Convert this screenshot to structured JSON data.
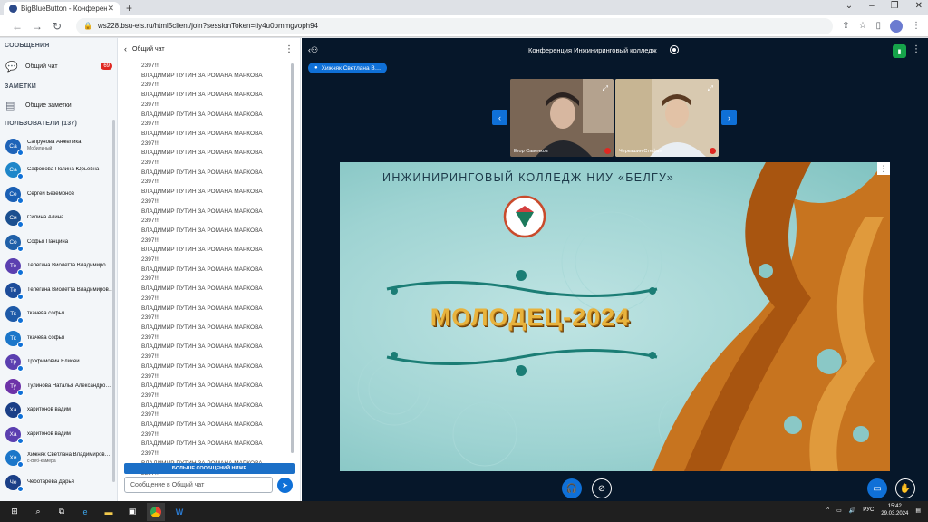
{
  "browser": {
    "tab_title": "BigBlueButton - Конферен…",
    "url": "ws228.bsu-eis.ru/html5client/join?sessionToken=tiy4u0pmmgvoph94"
  },
  "left_panel": {
    "messages_heading": "СООБЩЕНИЯ",
    "public_chat_label": "Общий чат",
    "public_chat_badge": "69",
    "notes_heading": "ЗАМЕТКИ",
    "shared_notes_label": "Общие заметки",
    "users_heading": "ПОЛЬЗОВАТЕЛИ (137)",
    "users": [
      {
        "initials": "Са",
        "name": "Сапрунова Анжелика",
        "sub": "Мобильный",
        "color": "#1e63b8"
      },
      {
        "initials": "Са",
        "name": "Сафонова Полина Юрьевна",
        "sub": "",
        "color": "#1e86c9"
      },
      {
        "initials": "Се",
        "name": "Сергей Беземонов",
        "sub": "",
        "color": "#1a5fb4"
      },
      {
        "initials": "Си",
        "name": "Силина Алина",
        "sub": "",
        "color": "#1b4f8f"
      },
      {
        "initials": "Со",
        "name": "Софья Панцина",
        "sub": "",
        "color": "#2060a8"
      },
      {
        "initials": "Те",
        "name": "Телегина Виолетта Владимиро…",
        "sub": "",
        "color": "#5b3fb0"
      },
      {
        "initials": "Те",
        "name": "Телегина Виолетта Владимиров…",
        "sub": "",
        "color": "#1d4c9a"
      },
      {
        "initials": "Тк",
        "name": "ткачева софья",
        "sub": "",
        "color": "#1e5aa8"
      },
      {
        "initials": "Тк",
        "name": "ткачева софья",
        "sub": "",
        "color": "#1b76c9"
      },
      {
        "initials": "Тр",
        "name": "Трофимович Елисей",
        "sub": "",
        "color": "#5b3fb0"
      },
      {
        "initials": "Ту",
        "name": "Тулинова Наталья Александро…",
        "sub": "",
        "color": "#6d32a8"
      },
      {
        "initials": "Ха",
        "name": "харитонов вадим",
        "sub": "",
        "color": "#1b3f87"
      },
      {
        "initials": "Ха",
        "name": "харитонов вадим",
        "sub": "",
        "color": "#5b3fb0"
      },
      {
        "initials": "Хи",
        "name": "Хижняк Светлана Владимиров…",
        "sub": "с-Веб-камера",
        "color": "#1b76c9"
      },
      {
        "initials": "Че",
        "name": "Чеботарева Дарья",
        "sub": "",
        "color": "#1b3f87"
      }
    ]
  },
  "chat": {
    "title": "Общий чат",
    "message_text": "ВЛАДИМИР ПУТИН ЗА РОМАНА МАРКОВА",
    "message_number": "2397!!!",
    "more_messages": "БОЛЬШЕ СООБЩЕНИЙ НИЖЕ",
    "input_placeholder": "Сообщение в Общий чат"
  },
  "main": {
    "conference_title": "Конференция Инжиниринговый колледж",
    "speaker_label": "Хижняк Светлана В…",
    "videos": [
      {
        "name": "Егор Савенков"
      },
      {
        "name": "Черкашин Стефан"
      }
    ],
    "slide": {
      "title": "ИНЖИНИРИНГОВЫЙ КОЛЛЕДЖ НИУ «БЕЛГУ»",
      "headline": "МОЛОДЕЦ-2024"
    }
  },
  "taskbar": {
    "language": "РУС",
    "time": "15:42",
    "date": "29.03.2024"
  },
  "icons": {
    "back": "chevron-left-icon",
    "send": "send-icon",
    "hand": "raise-hand-icon"
  }
}
